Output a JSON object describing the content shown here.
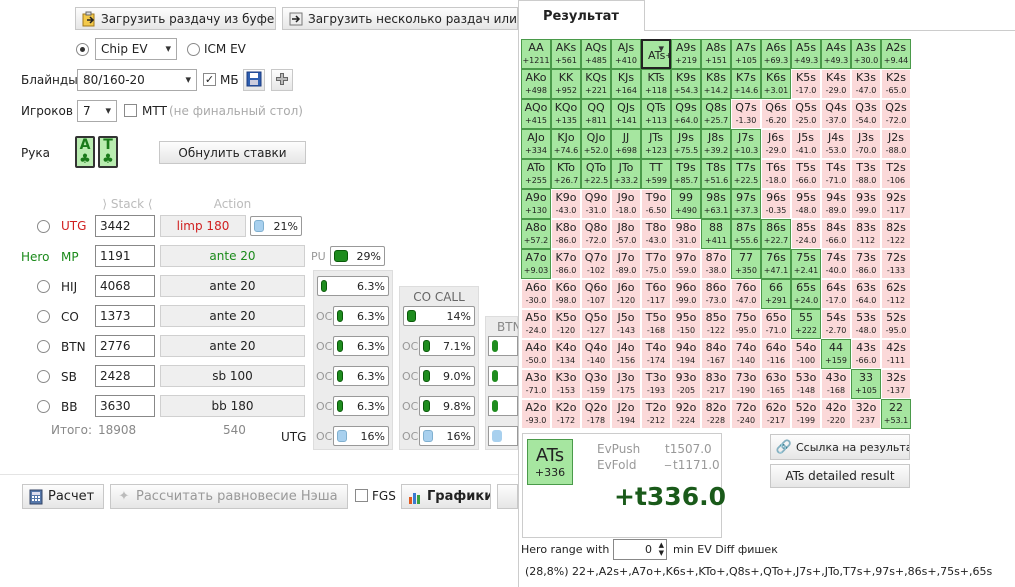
{
  "toolbar": {
    "load_buffer": "Загрузить раздачу из буфера",
    "load_many": "Загрузить несколько раздач или тур"
  },
  "model": {
    "chip_ev": "Chip EV",
    "icm_ev": "ICM EV"
  },
  "blinds": {
    "label": "Блайнды",
    "value": "80/160-20",
    "mb_label": "МБ"
  },
  "players": {
    "label": "Игроков",
    "value": "7",
    "mtt_label": "МТТ",
    "mtt_note": "(не финальный стол)"
  },
  "hand": {
    "label": "Рука",
    "reset_label": "Обнулить ставки",
    "card1": "A",
    "card2": "T"
  },
  "headers": {
    "stack": "Stack",
    "action": "Action",
    "co_call": "CO CALL",
    "btn": "BTN"
  },
  "seats": [
    {
      "pos": "UTG",
      "stack": "3442",
      "action": "limp 180",
      "pct": "21%"
    },
    {
      "hero": "Hero",
      "pos": "MP",
      "stack": "1191",
      "action": "ante 20",
      "pu": "PU",
      "pct": "29%"
    },
    {
      "pos": "HIJ",
      "stack": "4068",
      "action": "ante 20",
      "p1": "6.3%"
    },
    {
      "pos": "CO",
      "stack": "1373",
      "action": "ante 20",
      "p1": "6.3%",
      "p2": "14%"
    },
    {
      "pos": "BTN",
      "stack": "2776",
      "action": "ante 20",
      "p1": "6.3%",
      "p2": "7.1%"
    },
    {
      "pos": "SB",
      "stack": "2428",
      "action": "sb 100",
      "p1": "6.3%",
      "p2": "9.0%"
    },
    {
      "pos": "BB",
      "stack": "3630",
      "action": "bb 180",
      "p1": "6.3%",
      "p2": "9.8%"
    }
  ],
  "oc_label": "OC",
  "totals": {
    "label": "Итого:",
    "stack": "18908",
    "pot": "540",
    "utg": "UTG",
    "p1": "16%",
    "p2": "16%"
  },
  "bottom": {
    "calc": "Расчет",
    "nash": "Рассчитать равновесие Нэша",
    "fgs": "FGS",
    "charts": "Графики"
  },
  "result": {
    "tab": "Результат",
    "hand": "ATs",
    "hand_val": "+336",
    "evpush_label": "EvPush",
    "evpush": "t1507.0",
    "evfold_label": "EvFold",
    "evfold": "t1171.0",
    "diff": "+t336.0",
    "link_label": "Ссылка на результат",
    "detailed": "ATs detailed result",
    "hero_range_label": "Hero range with",
    "hero_range_val": "0",
    "hero_range_suffix": "min EV Diff фишек",
    "range_text": "(28,8%) 22+,A2s+,A7o+,K6s+,KTo+,Q8s+,QTo+,J7s+,JTo,T7s+,97s+,86s+,75s+,65s"
  },
  "matrix": [
    [
      [
        "AA",
        "+1211",
        "g"
      ],
      [
        "AKs",
        "+561",
        "g"
      ],
      [
        "AQs",
        "+485",
        "g"
      ],
      [
        "AJs",
        "+410",
        "g"
      ],
      [
        "ATs",
        "+336",
        "sel"
      ],
      [
        "A9s",
        "+219",
        "g"
      ],
      [
        "A8s",
        "+151",
        "g"
      ],
      [
        "A7s",
        "+105",
        "g"
      ],
      [
        "A6s",
        "+69.3",
        "g"
      ],
      [
        "A5s",
        "+49.3",
        "g"
      ],
      [
        "A4s",
        "+49.3",
        "g"
      ],
      [
        "A3s",
        "+30.0",
        "g"
      ],
      [
        "A2s",
        "+9.44",
        "g"
      ]
    ],
    [
      [
        "AKo",
        "+498",
        "g"
      ],
      [
        "KK",
        "+952",
        "g"
      ],
      [
        "KQs",
        "+221",
        "g"
      ],
      [
        "KJs",
        "+164",
        "g"
      ],
      [
        "KTs",
        "+118",
        "g"
      ],
      [
        "K9s",
        "+54.3",
        "g"
      ],
      [
        "K8s",
        "+14.2",
        "g"
      ],
      [
        "K7s",
        "+14.6",
        "g"
      ],
      [
        "K6s",
        "+3.01",
        "g"
      ],
      [
        "K5s",
        "-17.0",
        "r"
      ],
      [
        "K4s",
        "-29.0",
        "r"
      ],
      [
        "K3s",
        "-47.0",
        "r"
      ],
      [
        "K2s",
        "-65.0",
        "r"
      ]
    ],
    [
      [
        "AQo",
        "+415",
        "g"
      ],
      [
        "KQo",
        "+135",
        "g"
      ],
      [
        "QQ",
        "+811",
        "g"
      ],
      [
        "QJs",
        "+141",
        "g"
      ],
      [
        "QTs",
        "+113",
        "g"
      ],
      [
        "Q9s",
        "+64.0",
        "g"
      ],
      [
        "Q8s",
        "+25.7",
        "g"
      ],
      [
        "Q7s",
        "-1.30",
        "r"
      ],
      [
        "Q6s",
        "-6.20",
        "r"
      ],
      [
        "Q5s",
        "-25.0",
        "r"
      ],
      [
        "Q4s",
        "-37.0",
        "r"
      ],
      [
        "Q3s",
        "-54.0",
        "r"
      ],
      [
        "Q2s",
        "-72.0",
        "r"
      ]
    ],
    [
      [
        "AJo",
        "+334",
        "g"
      ],
      [
        "KJo",
        "+74.6",
        "g"
      ],
      [
        "QJo",
        "+52.0",
        "g"
      ],
      [
        "JJ",
        "+698",
        "g"
      ],
      [
        "JTs",
        "+123",
        "g"
      ],
      [
        "J9s",
        "+75.5",
        "g"
      ],
      [
        "J8s",
        "+39.2",
        "g"
      ],
      [
        "J7s",
        "+10.3",
        "g"
      ],
      [
        "J6s",
        "-29.0",
        "r"
      ],
      [
        "J5s",
        "-41.0",
        "r"
      ],
      [
        "J4s",
        "-53.0",
        "r"
      ],
      [
        "J3s",
        "-70.0",
        "r"
      ],
      [
        "J2s",
        "-88.0",
        "r"
      ]
    ],
    [
      [
        "ATo",
        "+255",
        "g"
      ],
      [
        "KTo",
        "+26.7",
        "g"
      ],
      [
        "QTo",
        "+22.5",
        "g"
      ],
      [
        "JTo",
        "+33.2",
        "g"
      ],
      [
        "TT",
        "+599",
        "g"
      ],
      [
        "T9s",
        "+85.7",
        "g"
      ],
      [
        "T8s",
        "+51.6",
        "g"
      ],
      [
        "T7s",
        "+22.5",
        "g"
      ],
      [
        "T6s",
        "-18.0",
        "r"
      ],
      [
        "T5s",
        "-66.0",
        "r"
      ],
      [
        "T4s",
        "-71.0",
        "r"
      ],
      [
        "T3s",
        "-88.0",
        "r"
      ],
      [
        "T2s",
        "-106",
        "r"
      ]
    ],
    [
      [
        "A9o",
        "+130",
        "g"
      ],
      [
        "K9o",
        "-43.0",
        "r"
      ],
      [
        "Q9o",
        "-31.0",
        "r"
      ],
      [
        "J9o",
        "-18.0",
        "r"
      ],
      [
        "T9o",
        "-6.50",
        "r"
      ],
      [
        "99",
        "+490",
        "g"
      ],
      [
        "98s",
        "+63.1",
        "g"
      ],
      [
        "97s",
        "+37.3",
        "g"
      ],
      [
        "96s",
        "-0.35",
        "r"
      ],
      [
        "95s",
        "-48.0",
        "r"
      ],
      [
        "94s",
        "-89.0",
        "r"
      ],
      [
        "93s",
        "-99.0",
        "r"
      ],
      [
        "92s",
        "-117",
        "r"
      ]
    ],
    [
      [
        "A8o",
        "+57.2",
        "g"
      ],
      [
        "K8o",
        "-86.0",
        "r"
      ],
      [
        "Q8o",
        "-72.0",
        "r"
      ],
      [
        "J8o",
        "-57.0",
        "r"
      ],
      [
        "T8o",
        "-43.0",
        "r"
      ],
      [
        "98o",
        "-31.0",
        "r"
      ],
      [
        "88",
        "+411",
        "g"
      ],
      [
        "87s",
        "+55.6",
        "g"
      ],
      [
        "86s",
        "+22.7",
        "g"
      ],
      [
        "85s",
        "-24.0",
        "r"
      ],
      [
        "84s",
        "-66.0",
        "r"
      ],
      [
        "83s",
        "-112",
        "r"
      ],
      [
        "82s",
        "-122",
        "r"
      ]
    ],
    [
      [
        "A7o",
        "+9.03",
        "g"
      ],
      [
        "K7o",
        "-86.0",
        "r"
      ],
      [
        "Q7o",
        "-102",
        "r"
      ],
      [
        "J7o",
        "-89.0",
        "r"
      ],
      [
        "T7o",
        "-75.0",
        "r"
      ],
      [
        "97o",
        "-59.0",
        "r"
      ],
      [
        "87o",
        "-38.0",
        "r"
      ],
      [
        "77",
        "+350",
        "g"
      ],
      [
        "76s",
        "+47.1",
        "g"
      ],
      [
        "75s",
        "+2.41",
        "g"
      ],
      [
        "74s",
        "-40.0",
        "r"
      ],
      [
        "73s",
        "-86.0",
        "r"
      ],
      [
        "72s",
        "-133",
        "r"
      ]
    ],
    [
      [
        "A6o",
        "-30.0",
        "r"
      ],
      [
        "K6o",
        "-98.0",
        "r"
      ],
      [
        "Q6o",
        "-107",
        "r"
      ],
      [
        "J6o",
        "-120",
        "r"
      ],
      [
        "T6o",
        "-117",
        "r"
      ],
      [
        "96o",
        "-99.0",
        "r"
      ],
      [
        "86o",
        "-73.0",
        "r"
      ],
      [
        "76o",
        "-47.0",
        "r"
      ],
      [
        "66",
        "+291",
        "g"
      ],
      [
        "65s",
        "+24.0",
        "g"
      ],
      [
        "64s",
        "-17.0",
        "r"
      ],
      [
        "63s",
        "-64.0",
        "r"
      ],
      [
        "62s",
        "-112",
        "r"
      ]
    ],
    [
      [
        "A5o",
        "-24.0",
        "r"
      ],
      [
        "K5o",
        "-120",
        "r"
      ],
      [
        "Q5o",
        "-127",
        "r"
      ],
      [
        "J5o",
        "-143",
        "r"
      ],
      [
        "T5o",
        "-168",
        "r"
      ],
      [
        "95o",
        "-150",
        "r"
      ],
      [
        "85o",
        "-122",
        "r"
      ],
      [
        "75o",
        "-95.0",
        "r"
      ],
      [
        "65o",
        "-71.0",
        "r"
      ],
      [
        "55",
        "+222",
        "g"
      ],
      [
        "54s",
        "-2.70",
        "r"
      ],
      [
        "53s",
        "-48.0",
        "r"
      ],
      [
        "52s",
        "-95.0",
        "r"
      ]
    ],
    [
      [
        "A4o",
        "-50.0",
        "r"
      ],
      [
        "K4o",
        "-134",
        "r"
      ],
      [
        "Q4o",
        "-140",
        "r"
      ],
      [
        "J4o",
        "-156",
        "r"
      ],
      [
        "T4o",
        "-174",
        "r"
      ],
      [
        "94o",
        "-194",
        "r"
      ],
      [
        "84o",
        "-167",
        "r"
      ],
      [
        "74o",
        "-140",
        "r"
      ],
      [
        "64o",
        "-116",
        "r"
      ],
      [
        "54o",
        "-100",
        "r"
      ],
      [
        "44",
        "+159",
        "g"
      ],
      [
        "43s",
        "-66.0",
        "r"
      ],
      [
        "42s",
        "-111",
        "r"
      ]
    ],
    [
      [
        "A3o",
        "-71.0",
        "r"
      ],
      [
        "K3o",
        "-153",
        "r"
      ],
      [
        "Q3o",
        "-159",
        "r"
      ],
      [
        "J3o",
        "-175",
        "r"
      ],
      [
        "T3o",
        "-193",
        "r"
      ],
      [
        "93o",
        "-205",
        "r"
      ],
      [
        "83o",
        "-217",
        "r"
      ],
      [
        "73o",
        "-190",
        "r"
      ],
      [
        "63o",
        "-165",
        "r"
      ],
      [
        "53o",
        "-148",
        "r"
      ],
      [
        "43o",
        "-168",
        "r"
      ],
      [
        "33",
        "+105",
        "g"
      ],
      [
        "32s",
        "-137",
        "r"
      ]
    ],
    [
      [
        "A2o",
        "-93.0",
        "r"
      ],
      [
        "K2o",
        "-172",
        "r"
      ],
      [
        "Q2o",
        "-178",
        "r"
      ],
      [
        "J2o",
        "-194",
        "r"
      ],
      [
        "T2o",
        "-212",
        "r"
      ],
      [
        "92o",
        "-224",
        "r"
      ],
      [
        "82o",
        "-228",
        "r"
      ],
      [
        "72o",
        "-240",
        "r"
      ],
      [
        "62o",
        "-217",
        "r"
      ],
      [
        "52o",
        "-199",
        "r"
      ],
      [
        "42o",
        "-220",
        "r"
      ],
      [
        "32o",
        "-237",
        "r"
      ],
      [
        "22",
        "+53.1",
        "g"
      ]
    ]
  ]
}
